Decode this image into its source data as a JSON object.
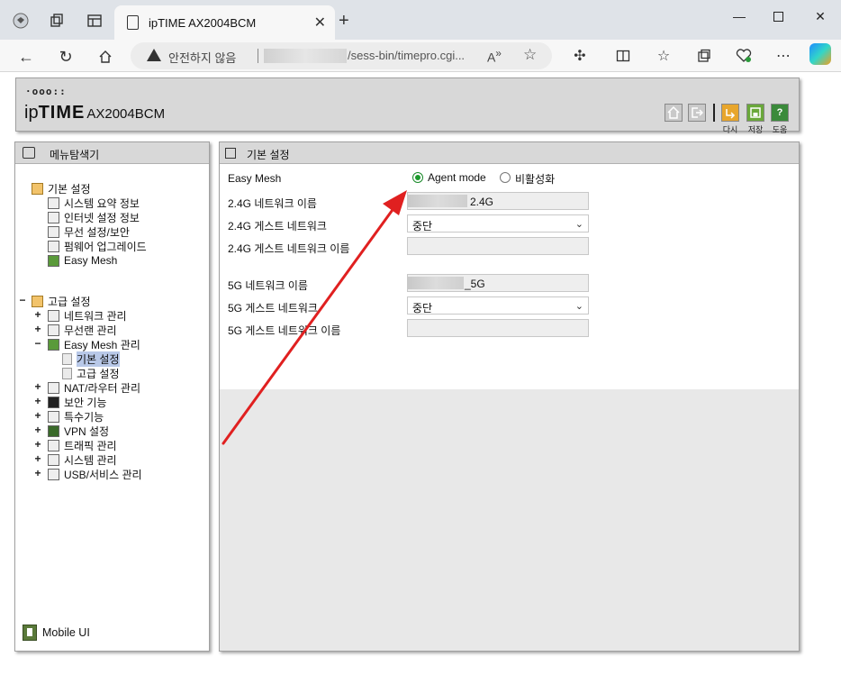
{
  "browser": {
    "tab_title": "ipTIME AX2004BCM",
    "security_warning": "안전하지 않음",
    "url_path": "/sess-bin/timepro.cgi..."
  },
  "header": {
    "logo_dots": "·ooo::",
    "brand_ip": "ip",
    "brand_time": "TIME",
    "model": "AX2004BCM",
    "buttons": [
      {
        "icon": "home-icon",
        "label": ""
      },
      {
        "icon": "logout-icon",
        "label": ""
      },
      {
        "icon": "refresh-icon",
        "label": "다시"
      },
      {
        "icon": "save-icon",
        "label": "저장"
      },
      {
        "icon": "help-icon",
        "label": "도움"
      }
    ],
    "colors": {
      "refresh": "#e8a62c",
      "save": "#6aa83a",
      "help": "#3a8a3a"
    }
  },
  "sidebar": {
    "title": "메뉴탐색기",
    "basic": {
      "label": "기본 설정",
      "items": [
        "시스템 요약 정보",
        "인터넷 설정 정보",
        "무선 설정/보안",
        "펌웨어 업그레이드",
        "Easy Mesh"
      ]
    },
    "advanced": {
      "label": "고급 설정",
      "items": [
        {
          "label": "네트워크 관리",
          "expander": "+"
        },
        {
          "label": "무선랜 관리",
          "expander": "+"
        },
        {
          "label": "Easy Mesh 관리",
          "expander": "−"
        },
        {
          "label": "NAT/라우터 관리",
          "expander": "+"
        },
        {
          "label": "보안 기능",
          "expander": "+"
        },
        {
          "label": "특수기능",
          "expander": "+"
        },
        {
          "label": "VPN 설정",
          "expander": "+"
        },
        {
          "label": "트래픽 관리",
          "expander": "+"
        },
        {
          "label": "시스템 관리",
          "expander": "+"
        },
        {
          "label": "USB/서비스 관리",
          "expander": "+"
        }
      ],
      "mesh_children": [
        "기본 설정",
        "고급 설정"
      ],
      "advanced_expander": "−"
    },
    "mobile_ui": "Mobile UI"
  },
  "content": {
    "title": "기본 설정",
    "easy_mesh_label": "Easy Mesh",
    "mode_options": [
      "Agent mode",
      "비활성화"
    ],
    "mode_selected": "Agent mode",
    "net24_name_label": "2.4G 네트워크 이름",
    "net24_name_suffix": "2.4G",
    "guest24_label": "2.4G 게스트 네트워크",
    "guest24_value": "중단",
    "guest24_name_label": "2.4G 게스트 네트워크 이름",
    "net5_name_label": "5G 네트워크 이름",
    "net5_name_suffix": "_5G",
    "guest5_label": "5G 게스트 네트워크",
    "guest5_value": "중단",
    "guest5_name_label": "5G 게스트 네트워크 이름"
  },
  "annotation": {
    "arrow_color": "#e02020"
  }
}
